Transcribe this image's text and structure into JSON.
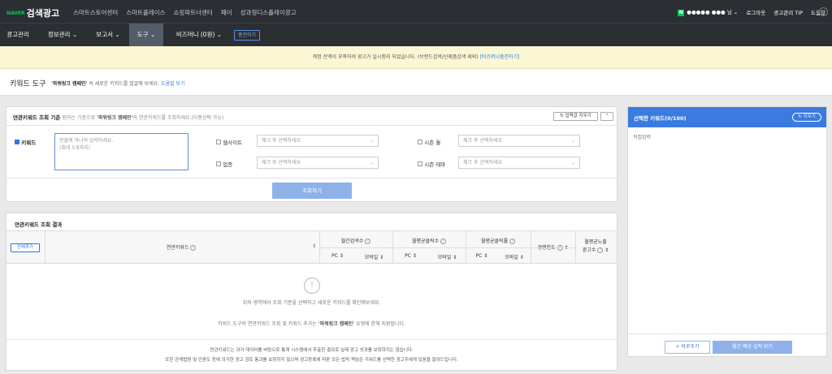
{
  "topbar": {
    "naver_mark": "NAVER",
    "app_title": "검색광고",
    "nav": [
      "스마트스토어센터",
      "스마트플레이스",
      "쇼핑파트너센터",
      "페이",
      "성과형디스플레이광고"
    ],
    "user_name": "●●●●● ●●●",
    "user_suffix": "님",
    "logout": "로그아웃",
    "tip": "광고관리 TIP",
    "help": "도움말"
  },
  "menu": {
    "items": [
      "광고관리",
      "정보관리",
      "보고서",
      "도구",
      "비즈머니 (0원)"
    ],
    "charge": "충전하기"
  },
  "notice": {
    "text": "계정 잔액이 부족하여 광고가 일시중지 되었습니다. (브랜드검색/신제품검색 제외)",
    "link": "[비즈머니충전하기]"
  },
  "page": {
    "title": "키워드 도구",
    "desc_campaign": "'파워링크 캠페인'",
    "desc_text": "의 새로운 키워드를 발굴해 보세요.",
    "desc_link": "도움말 보기"
  },
  "query": {
    "title": "연관키워드 조회 기준",
    "desc_pre": "원하는 기준으로",
    "desc_campaign": "'파워링크 캠페인'",
    "desc_post": "의 연관키워드를 조회하세요.(다중선택 가능)",
    "reset": "입력값 지우기",
    "keyword_label": "키워드",
    "keyword_placeholder_1": "한줄에 하나씩 입력하세요.",
    "keyword_placeholder_2": "(최대 5개까지)",
    "website_label": "웹사이트",
    "industry_label": "업종",
    "season_month_label": "시즌 월",
    "season_theme_label": "시즌 테마",
    "select_placeholder": "체크 후 선택하세요",
    "submit": "조회하기",
    "keyword_checked": true
  },
  "results": {
    "title": "연관키워드 조회 결과",
    "add_all": "전체추가",
    "col_keyword": "연관키워드",
    "col_monthly_search": "월간검색수",
    "col_monthly_click": "월평균클릭수",
    "col_monthly_ctr": "월평균클릭률",
    "col_competition": "경쟁정도",
    "col_ad_count_1": "월평균노출",
    "col_ad_count_2": "광고수",
    "sub_pc": "PC",
    "sub_mobile": "모바일",
    "empty_1": "위의 영역에서 조회 기준을 선택하고 새로운 키워드를 확인해보세요.",
    "empty_2_pre": "키워드 도구의 연관키워드 조회 및 키워드 추가는",
    "empty_2_campaign": "'파워링크 캠페인'",
    "empty_2_post": "유형에 한해 지원됩니다.",
    "footer_1": "연관키워드는 과거 데이터를 바탕으로 통계 시스템에서 추출한 결과로 실제 광고 성과를 보장하지는 않습니다.",
    "footer_2": "또한 관계법령 및 언론도 등에 의거한 광고 검토 통과를 보장하지 않으며 광고등록에 따른 모든 법적 책임은 키워드를 선택한 광고주에게 있음을 알려드립니다."
  },
  "selected": {
    "title": "선택한 키워드(0/100)",
    "clear": "지우기",
    "direct_input": "직접입력",
    "add": "+ 바로추가",
    "estimate": "월간 예상 실적 보기"
  },
  "colors": {
    "topbar_bg": "#2b2f33",
    "accent": "#2a7ae2",
    "notice_bg": "#fbf6d3",
    "panel_header": "#3b7be0"
  }
}
